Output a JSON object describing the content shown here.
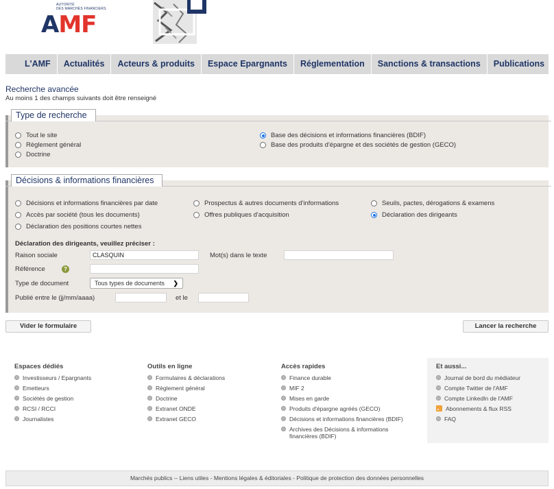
{
  "header": {
    "logo_small_line1": "AUTORITÉ",
    "logo_small_line2": "DES MARCHÉS FINANCIERS",
    "logo_a": "A",
    "logo_m": "M",
    "logo_f": "F"
  },
  "nav": {
    "items": [
      "L'AMF",
      "Actualités",
      "Acteurs & produits",
      "Espace Epargnants",
      "Réglementation",
      "Sanctions & transactions",
      "Publications"
    ]
  },
  "page": {
    "title": "Recherche avancée",
    "subtitle": "Au moins 1 des champs suivants doit être renseigné"
  },
  "type_recherche": {
    "legend": "Type de recherche",
    "options": [
      {
        "label": "Tout le site",
        "selected": false
      },
      {
        "label": "Règlement général",
        "selected": false
      },
      {
        "label": "Doctrine",
        "selected": false
      },
      {
        "label": "Base des décisions et informations financières (BDIF)",
        "selected": true
      },
      {
        "label": "Base des produits d'épargne et des sociétés de gestion (GECO)",
        "selected": false
      }
    ]
  },
  "decisions": {
    "legend": "Décisions & informations financières",
    "options": [
      {
        "label": "Décisions et informations financières par date",
        "selected": false
      },
      {
        "label": "Accès par société (tous les documents)",
        "selected": false
      },
      {
        "label": "Déclaration des positions courtes nettes",
        "selected": false
      },
      {
        "label": "Prospectus & autres documents d'informations",
        "selected": false
      },
      {
        "label": "Offres publiques d'acquisition",
        "selected": false
      },
      {
        "label": "Seuils, pactes, dérogations & examens",
        "selected": false
      },
      {
        "label": "Déclaration des dirigeants",
        "selected": true
      }
    ],
    "precise_label": "Déclaration des dirigeants, veuillez préciser :",
    "raison_sociale_label": "Raison sociale",
    "raison_sociale_value": "CLASQUIN",
    "mots_label": "Mot(s) dans le texte",
    "mots_value": "",
    "reference_label": "Référence",
    "help_glyph": "?",
    "reference_value": "",
    "type_doc_label": "Type de document",
    "type_doc_value": "Tous types de documents",
    "publie_label": "Publié entre le (jj/mm/aaaa)",
    "date_from": "",
    "et_le_label": "et le",
    "date_to": ""
  },
  "buttons": {
    "clear": "Vider le formulaire",
    "search": "Lancer la recherche"
  },
  "footer": {
    "espaces": {
      "title": "Espaces dédiés",
      "links": [
        "Investisseurs / Epargnants",
        "Emetteurs",
        "Sociétés de gestion",
        "RCSI / RCCI",
        "Journalistes"
      ]
    },
    "outils": {
      "title": "Outils en ligne",
      "links": [
        "Formulaires & déclarations",
        "Règlement général",
        "Doctrine",
        "Extranet ONDE",
        "Extranet GECO"
      ]
    },
    "acces": {
      "title": "Accès rapides",
      "links": [
        "Finance durable",
        "MIF 2",
        "Mises en garde",
        "Produits d'épargne agréés (GECO)",
        "Décisions et informations financières (BDIF)",
        "Archives des Décisions & informations financières (BDIF)"
      ]
    },
    "aussi": {
      "title": "Et aussi...",
      "links": [
        "Journal de bord du médiateur",
        "Compte Twitter de l'AMF",
        "Compte LinkedIn de l'AMF",
        "Abonnements & flux RSS",
        "FAQ"
      ]
    },
    "bottom": {
      "marches": "Marchés publics",
      "sep1": " -- ",
      "liens": "Liens utiles",
      "sep2": " - ",
      "mentions": "Mentions légales & éditoriales",
      "sep3": " - ",
      "politique": "Politique de protection des données personnelles"
    }
  },
  "colors": {
    "brand_navy": "#1f3566",
    "brand_red": "#e2342c",
    "panel_bg": "#ece8e4",
    "radio_selected": "#1a73e8"
  }
}
